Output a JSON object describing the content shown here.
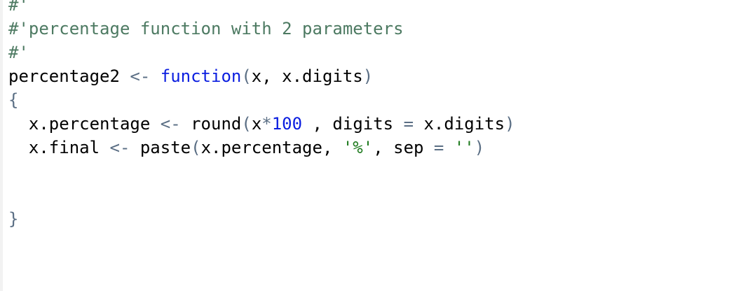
{
  "editor": {
    "lines": [
      {
        "tokens": [
          {
            "text": "#'",
            "kind": "comment"
          }
        ]
      },
      {
        "tokens": [
          {
            "text": "#'percentage function with 2 parameters",
            "kind": "comment"
          }
        ]
      },
      {
        "tokens": [
          {
            "text": "#'",
            "kind": "comment"
          }
        ]
      },
      {
        "tokens": [
          {
            "text": "percentage2 ",
            "kind": "plain"
          },
          {
            "text": "<-",
            "kind": "op"
          },
          {
            "text": " ",
            "kind": "plain"
          },
          {
            "text": "function",
            "kind": "kw"
          },
          {
            "text": "(",
            "kind": "op"
          },
          {
            "text": "x, x.digits",
            "kind": "plain"
          },
          {
            "text": ")",
            "kind": "op"
          }
        ]
      },
      {
        "tokens": [
          {
            "text": "{",
            "kind": "op"
          }
        ]
      },
      {
        "tokens": [
          {
            "text": "  x.percentage ",
            "kind": "plain"
          },
          {
            "text": "<-",
            "kind": "op"
          },
          {
            "text": " round",
            "kind": "plain"
          },
          {
            "text": "(",
            "kind": "op"
          },
          {
            "text": "x",
            "kind": "plain"
          },
          {
            "text": "*",
            "kind": "op"
          },
          {
            "text": "100",
            "kind": "num"
          },
          {
            "text": " , digits ",
            "kind": "plain"
          },
          {
            "text": "=",
            "kind": "op"
          },
          {
            "text": " x.digits",
            "kind": "plain"
          },
          {
            "text": ")",
            "kind": "op"
          }
        ]
      },
      {
        "tokens": [
          {
            "text": "  x.final ",
            "kind": "plain"
          },
          {
            "text": "<-",
            "kind": "op"
          },
          {
            "text": " paste",
            "kind": "plain"
          },
          {
            "text": "(",
            "kind": "op"
          },
          {
            "text": "x.percentage, ",
            "kind": "plain"
          },
          {
            "text": "'%'",
            "kind": "str"
          },
          {
            "text": ", sep ",
            "kind": "plain"
          },
          {
            "text": "=",
            "kind": "op"
          },
          {
            "text": " ",
            "kind": "plain"
          },
          {
            "text": "''",
            "kind": "str"
          },
          {
            "text": ")",
            "kind": "op"
          }
        ]
      },
      {
        "tokens": []
      },
      {
        "tokens": []
      },
      {
        "tokens": [
          {
            "text": "}",
            "kind": "op"
          }
        ]
      }
    ]
  },
  "colors": {
    "comment": "#4d7a62",
    "operator": "#5a6e84",
    "keyword": "#0b1ee0",
    "number": "#0b1ee0",
    "string": "#1d7a1d",
    "plain": "#000000"
  }
}
